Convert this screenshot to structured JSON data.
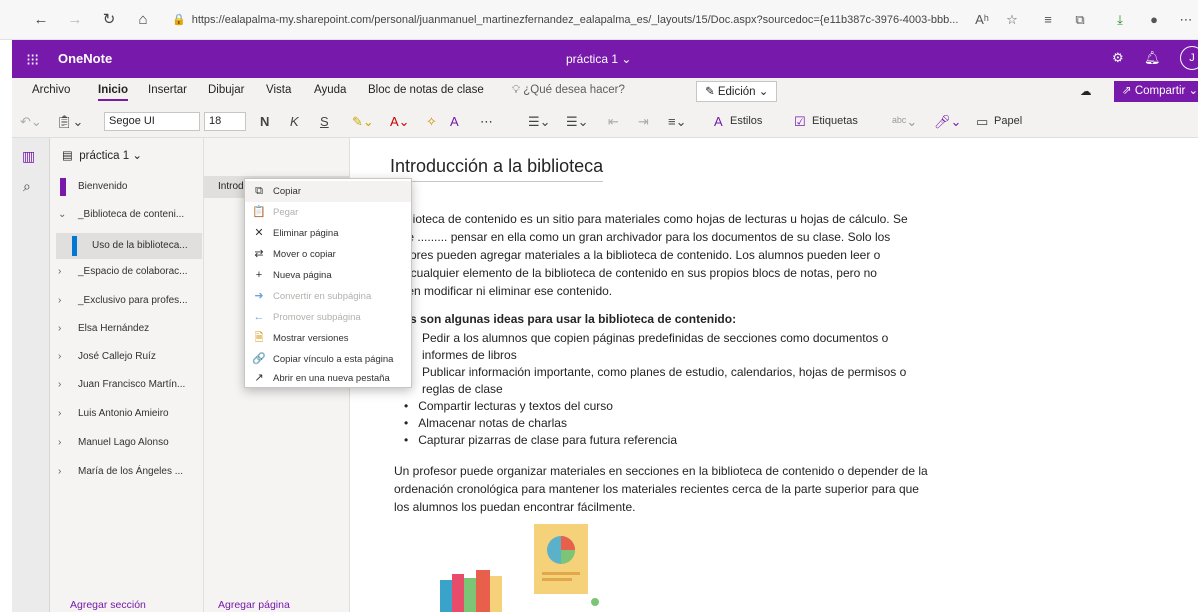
{
  "browser": {
    "url": "https://ealapalma-my.sharepoint.com/personal/juanmanuel_martinezfernandez_ealapalma_es/_layouts/15/Doc.aspx?sourcedoc={e11b387c-3976-4003-bbb...",
    "read_aloud": "Aʰ"
  },
  "app": {
    "name": "OneNote",
    "doc_title": "práctica 1 ⌄",
    "avatar_initial": "J"
  },
  "tabs": [
    "Archivo",
    "Inicio",
    "Insertar",
    "Dibujar",
    "Vista",
    "Ayuda",
    "Bloc de notas de clase"
  ],
  "active_tab": "Inicio",
  "help_search": "¿Qué desea hacer?",
  "edit_mode": "Edición",
  "share_label": "Compartir",
  "toolbar": {
    "font": "Segoe UI",
    "size": "18",
    "bold": "N",
    "italic": "K",
    "underline": "S",
    "styles": "Estilos",
    "tags": "Etiquetas",
    "paper": "Papel"
  },
  "notebook": "práctica 1",
  "sections": [
    {
      "label": "Bienvenido",
      "chev": ""
    },
    {
      "label": "_Biblioteca de conteni...",
      "chev": "⌄"
    },
    {
      "label": "Uso de la biblioteca...",
      "chev": ""
    },
    {
      "label": "_Espacio de colaborac...",
      "chev": "›"
    },
    {
      "label": "_Exclusivo para profes...",
      "chev": "›"
    },
    {
      "label": "Elsa Hernández",
      "chev": "›"
    },
    {
      "label": "José Callejo Ruíz",
      "chev": "›"
    },
    {
      "label": "Juan Francisco Martín...",
      "chev": "›"
    },
    {
      "label": "Luis Antonio Amieiro",
      "chev": "›"
    },
    {
      "label": "Manuel Lago Alonso",
      "chev": "›"
    },
    {
      "label": "María de los Ángeles ...",
      "chev": "›"
    }
  ],
  "page_item": "Introd",
  "add_section": "Agregar sección",
  "add_page": "Agregar página",
  "context_menu": [
    {
      "label": "Copiar",
      "icon": "⧉",
      "disabled": false
    },
    {
      "label": "Pegar",
      "icon": "📋",
      "disabled": true
    },
    {
      "label": "Eliminar página",
      "icon": "✕",
      "disabled": false
    },
    {
      "label": "Mover o copiar",
      "icon": "⇄",
      "disabled": false
    },
    {
      "label": "Nueva página",
      "icon": "+",
      "disabled": false
    },
    {
      "label": "Convertir en subpágina",
      "icon": "➜",
      "disabled": true
    },
    {
      "label": "Promover subpágina",
      "icon": "←",
      "disabled": true
    },
    {
      "label": "Mostrar versiones",
      "icon": "🗎",
      "disabled": false
    },
    {
      "label": "Copiar vínculo a esta página",
      "icon": "🔗",
      "disabled": false
    },
    {
      "label": "Abrir en una nueva pestaña",
      "icon": "↗",
      "disabled": false
    }
  ],
  "content": {
    "title": "Introducción a la biblioteca",
    "p1_lines": [
      "biblioteca de contenido es un sitio para materiales como hojas de lecturas u hojas de cálculo. Se",
      "ede ......... pensar en ella como un gran archivador para los documentos de su clase. Solo los",
      "fesores pueden agregar materiales a la biblioteca de contenido. Los alumnos pueden leer o",
      "iar cualquier elemento de la biblioteca de contenido en sus propios blocs de notas, pero no",
      "eden modificar ni eliminar ese contenido."
    ],
    "ideas_heading": "s son algunas ideas para usar la biblioteca de contenido:",
    "bullets": [
      "Pedir a los alumnos que copien páginas predefinidas de secciones como documentos o",
      "informes de libros",
      "Publicar información importante, como planes de estudio, calendarios, hojas de permisos o",
      "reglas de clase",
      "Compartir lecturas y textos del curso",
      "Almacenar notas de charlas",
      "Capturar pizarras de clase para futura referencia"
    ],
    "p2_lines": [
      "Un profesor puede organizar materiales en secciones en la biblioteca de contenido o depender de la",
      "ordenación cronológica para mantener los materiales recientes cerca de la parte superior para que",
      "los alumnos los puedan encontrar fácilmente."
    ]
  }
}
